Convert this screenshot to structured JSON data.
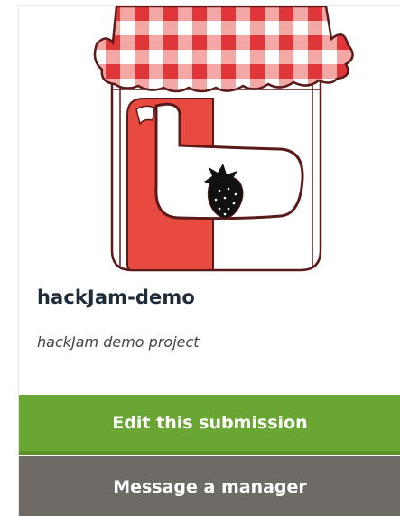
{
  "submission": {
    "title": "hackJam-demo",
    "tagline": "hackJam demo project",
    "image_icon": "jam-jar-strawberry-logo"
  },
  "actions": {
    "edit_label": "Edit this submission",
    "message_label": "Message a manager"
  },
  "colors": {
    "edit_button": "#6aa633",
    "message_button": "#6e6a66",
    "title_text": "#1e2b38",
    "jam_red": "#e84a40"
  }
}
